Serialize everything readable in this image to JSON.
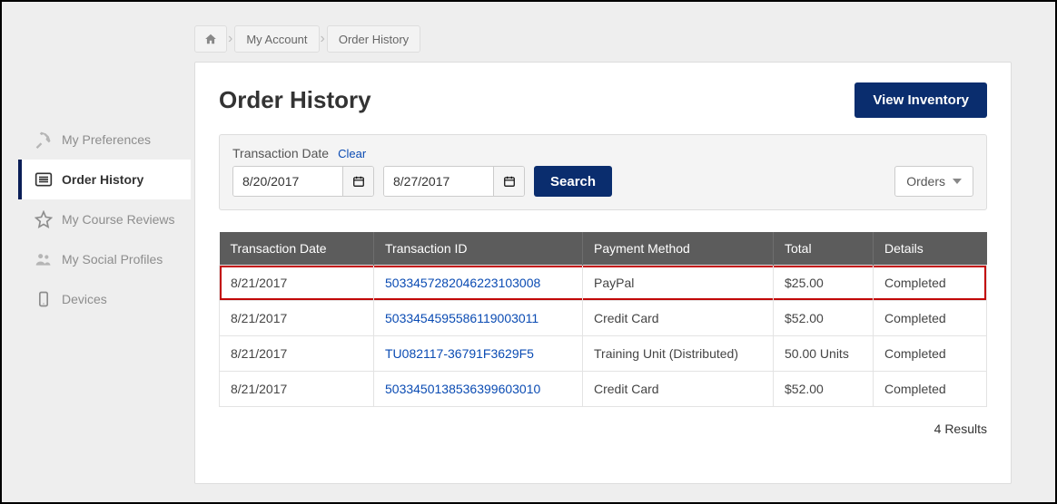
{
  "breadcrumb": {
    "items": [
      "My Account",
      "Order History"
    ]
  },
  "sidebar": {
    "items": [
      {
        "label": "My Preferences",
        "icon": "tools"
      },
      {
        "label": "Order History",
        "icon": "list",
        "active": true
      },
      {
        "label": "My Course Reviews",
        "icon": "star"
      },
      {
        "label": "My Social Profiles",
        "icon": "people"
      },
      {
        "label": "Devices",
        "icon": "device"
      }
    ]
  },
  "page": {
    "title": "Order History",
    "view_inventory": "View Inventory"
  },
  "filter": {
    "label": "Transaction Date",
    "clear": "Clear",
    "from": "8/20/2017",
    "to": "8/27/2017",
    "search": "Search",
    "orders_label": "Orders"
  },
  "table": {
    "columns": [
      "Transaction Date",
      "Transaction ID",
      "Payment Method",
      "Total",
      "Details"
    ],
    "rows": [
      {
        "date": "8/21/2017",
        "id": "5033457282046223103008",
        "method": "PayPal",
        "total": "$25.00",
        "details": "Completed",
        "highlight": true
      },
      {
        "date": "8/21/2017",
        "id": "5033454595586119003011",
        "method": "Credit Card",
        "total": "$52.00",
        "details": "Completed"
      },
      {
        "date": "8/21/2017",
        "id": "TU082117-36791F3629F5",
        "method": "Training Unit (Distributed)",
        "total": "50.00 Units",
        "details": "Completed"
      },
      {
        "date": "8/21/2017",
        "id": "5033450138536399603010",
        "method": "Credit Card",
        "total": "$52.00",
        "details": "Completed"
      }
    ],
    "results_text": "4 Results"
  }
}
